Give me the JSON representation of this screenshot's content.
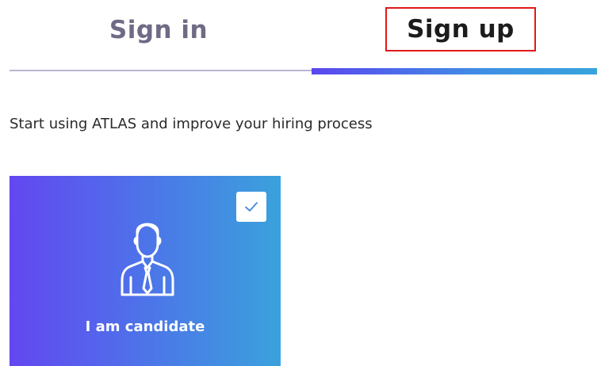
{
  "tabs": {
    "signin_label": "Sign in",
    "signup_label": "Sign up",
    "active": "signup"
  },
  "subtitle": "Start using ATLAS and improve your hiring process",
  "card": {
    "label": "I am candidate",
    "selected": true,
    "icon": "candidate-person-icon",
    "check_icon": "checkmark-icon"
  },
  "colors": {
    "accent_start": "#5b47ef",
    "accent_end": "#37a4dc",
    "highlight_box": "#e01919",
    "inactive_tab": "#6e6b86"
  }
}
